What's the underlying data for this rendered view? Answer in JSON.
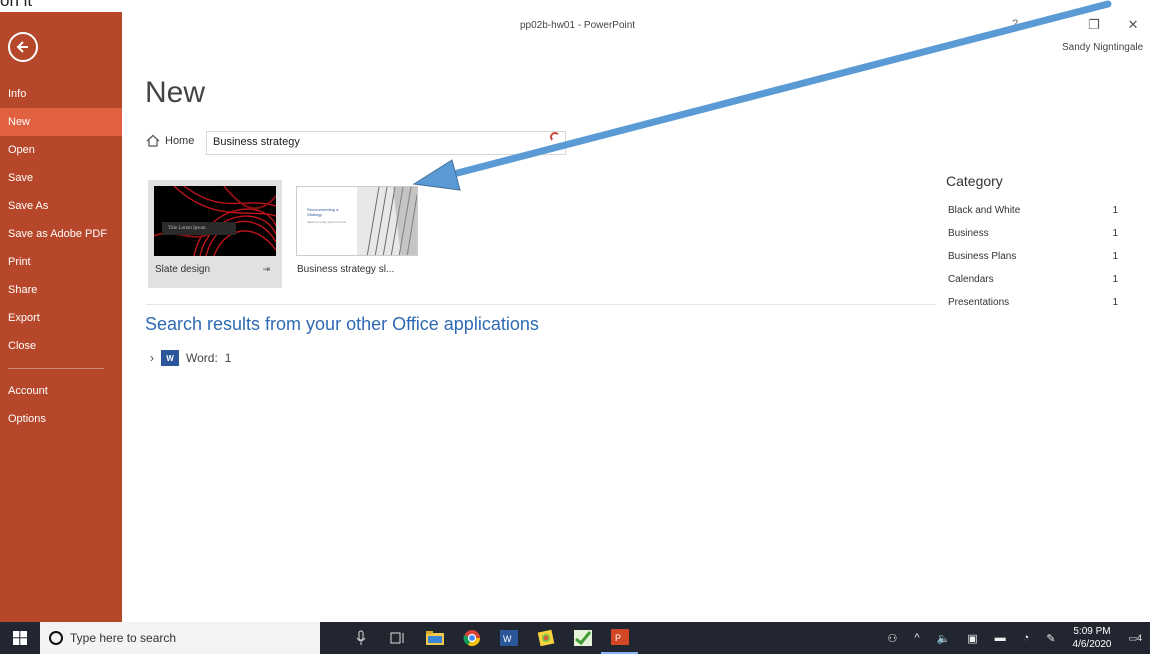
{
  "top_strip_text": "on it",
  "window": {
    "title": "pp02b-hw01  -  PowerPoint",
    "help": "?",
    "restore_glyph": "❐",
    "close_glyph": "✕",
    "user_name": "Sandy Nigntingale"
  },
  "sidebar": {
    "items": [
      {
        "label": "Info"
      },
      {
        "label": "New"
      },
      {
        "label": "Open"
      },
      {
        "label": "Save"
      },
      {
        "label": "Save As"
      },
      {
        "label": "Save as Adobe PDF"
      },
      {
        "label": "Print"
      },
      {
        "label": "Share"
      },
      {
        "label": "Export"
      },
      {
        "label": "Close"
      },
      {
        "label": "Account"
      },
      {
        "label": "Options"
      }
    ]
  },
  "main": {
    "title": "New",
    "home_label": "Home",
    "search_value": "Business strategy",
    "templates": [
      {
        "name": "Slate design",
        "thumb_text": "Title Lorem Ipsum",
        "pin": "⇥"
      },
      {
        "name": "Business strategy sl...",
        "thumb_title": "Recommending a Strategy",
        "thumb_sub": "Ideas for today and tomorrow"
      }
    ],
    "other_apps_title": "Search results from your other Office applications",
    "word_row": {
      "arrow": "›",
      "icon_text": "W",
      "label": "Word:",
      "count": "1"
    }
  },
  "category": {
    "title": "Category",
    "items": [
      {
        "name": "Black and White",
        "count": "1"
      },
      {
        "name": "Business",
        "count": "1"
      },
      {
        "name": "Business Plans",
        "count": "1"
      },
      {
        "name": "Calendars",
        "count": "1"
      },
      {
        "name": "Presentations",
        "count": "1"
      }
    ]
  },
  "taskbar": {
    "search_placeholder": "Type here to search",
    "time": "5:09 PM",
    "date": "4/6/2020",
    "notification_count": "4"
  },
  "colors": {
    "sidebar": "#b7472a",
    "sidebar_active": "#e0603f",
    "accent_blue": "#2e6ab3",
    "arrow": "#5b9bd5",
    "taskbar": "#212630"
  }
}
